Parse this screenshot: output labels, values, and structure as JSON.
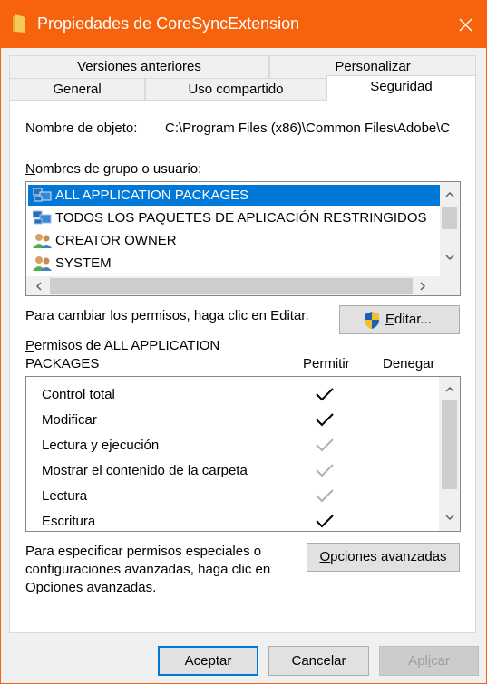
{
  "window": {
    "title": "Propiedades de CoreSyncExtension",
    "accent": "#f7630c"
  },
  "tabs": [
    {
      "label": "Versiones anteriores",
      "active": false
    },
    {
      "label": "Personalizar",
      "active": false
    },
    {
      "label": "General",
      "active": false
    },
    {
      "label": "Uso compartido",
      "active": false
    },
    {
      "label": "Seguridad",
      "active": true
    }
  ],
  "security": {
    "object_label": "Nombre de objeto:",
    "object_value": "C:\\Program Files (x86)\\Common Files\\Adobe\\C",
    "groups_label_accel": "N",
    "groups_label_rest": "ombres de grupo o usuario:",
    "groups": [
      {
        "name": "ALL APPLICATION PACKAGES",
        "icon": "package-group-icon",
        "selected": true
      },
      {
        "name": "TODOS LOS PAQUETES DE APLICACIÓN RESTRINGIDOS",
        "icon": "package-group-icon",
        "selected": false
      },
      {
        "name": "CREATOR OWNER",
        "icon": "users-icon",
        "selected": false
      },
      {
        "name": "SYSTEM",
        "icon": "users-icon",
        "selected": false
      }
    ],
    "change_hint": "Para cambiar los permisos, haga clic en Editar.",
    "edit_button_accel": "E",
    "edit_button_rest": "ditar...",
    "perms_title_accel": "P",
    "perms_title_line1": "ermisos de ALL APPLICATION",
    "perms_title_line2": "PACKAGES",
    "col_allow": "Permitir",
    "col_deny": "Denegar",
    "permissions": [
      {
        "name": "Control total",
        "allow": "checked"
      },
      {
        "name": "Modificar",
        "allow": "checked"
      },
      {
        "name": "Lectura y ejecución",
        "allow": "inherited"
      },
      {
        "name": "Mostrar el contenido de la carpeta",
        "allow": "inherited"
      },
      {
        "name": "Lectura",
        "allow": "inherited"
      },
      {
        "name": "Escritura",
        "allow": "checked"
      }
    ],
    "advanced_hint_line1": "Para especificar permisos especiales o",
    "advanced_hint_line2": "configuraciones avanzadas, haga clic en",
    "advanced_hint_line3": "Opciones avanzadas.",
    "advanced_button_accel": "O",
    "advanced_button_rest": "pciones avanzadas"
  },
  "footer": {
    "ok_label": "Aceptar",
    "cancel_label": "Cancelar",
    "apply_prefix": "Apl",
    "apply_accel": "i",
    "apply_suffix": "car"
  },
  "colors": {
    "selection": "#0078d7",
    "check_active": "#000000",
    "check_inherited": "#b0b0b0"
  }
}
